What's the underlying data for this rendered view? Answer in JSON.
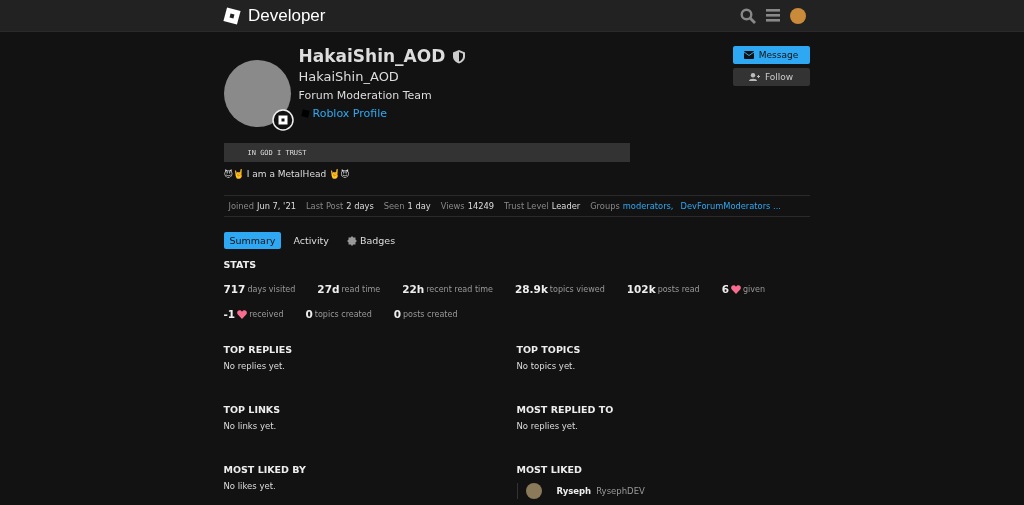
{
  "header": {
    "title": "Developer"
  },
  "profile": {
    "username": "HakaiShin_AOD",
    "name": "HakaiShin_AOD",
    "title": "Forum Moderation Team",
    "profile_link": "Roblox Profile",
    "bio_code": "IN GOD I TRUST",
    "bio": "😈🤘 I am a MetalHead 🤘😈"
  },
  "actions": [
    {
      "kind": "message",
      "label": "Message"
    },
    {
      "kind": "follow",
      "label": "Follow"
    }
  ],
  "meta": [
    {
      "label": "Joined",
      "value": "Jun 7, '21"
    },
    {
      "label": "Last Post",
      "value": "2 days"
    },
    {
      "label": "Seen",
      "value": "1 day"
    },
    {
      "label": "Views",
      "value": "14249"
    },
    {
      "label": "Trust Level",
      "value": "Leader"
    }
  ],
  "groups": {
    "label": "Groups",
    "links": [
      "moderators,",
      "DevForumModerators ..."
    ]
  },
  "tabs": [
    {
      "label": "Summary",
      "selected": true
    },
    {
      "label": "Activity",
      "selected": false
    },
    {
      "label": "Badges",
      "selected": false,
      "kind": "badges"
    }
  ],
  "stats": {
    "title": "STATS",
    "rows": [
      [
        {
          "value": "717",
          "label": "days visited"
        },
        {
          "value": "27d",
          "label": "read time"
        },
        {
          "value": "22h",
          "label": "recent read time"
        },
        {
          "value": "28.9k",
          "label": "topics viewed"
        },
        {
          "value": "102k",
          "label": "posts read"
        },
        {
          "value": "6",
          "label": "given",
          "kind": "likes"
        }
      ],
      [
        {
          "value": "-1",
          "label": "received",
          "kind": "likes"
        },
        {
          "value": "0",
          "label": "topics created"
        },
        {
          "value": "0",
          "label": "posts created"
        }
      ]
    ]
  },
  "sections": [
    {
      "title": "TOP REPLIES",
      "empty": "No replies yet."
    },
    {
      "title": "TOP TOPICS",
      "empty": "No topics yet."
    },
    {
      "title": "TOP LINKS",
      "empty": "No links yet."
    },
    {
      "title": "MOST REPLIED TO",
      "empty": "No replies yet."
    },
    {
      "title": "MOST LIKED BY",
      "empty": "No likes yet."
    },
    {
      "title": "MOST LIKED",
      "users": [
        {
          "name": "Ryseph",
          "username": "RysephDEV"
        }
      ]
    }
  ]
}
